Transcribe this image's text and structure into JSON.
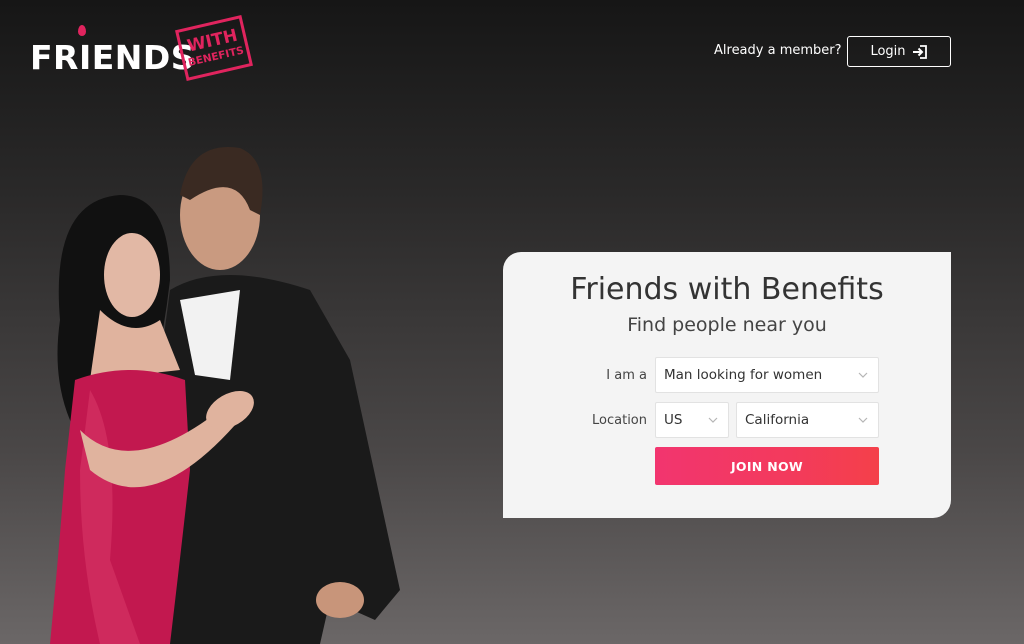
{
  "brand": {
    "name": "FRIENDS",
    "stamp_line1": "WITH",
    "stamp_line2": "BENEFITS",
    "accent_color": "#e0245e"
  },
  "header": {
    "member_prompt": "Already a member?",
    "login_label": "Login",
    "login_icon": "login-icon"
  },
  "hero": {
    "image_subject": "couple-photo"
  },
  "signup": {
    "title": "Friends with Benefits",
    "subtitle": "Find people near you",
    "iam_label": "I am a",
    "iam_value": "Man looking for women",
    "location_label": "Location",
    "country_value": "US",
    "region_value": "California",
    "join_label": "JOIN NOW",
    "join_color": "#f33a5c"
  }
}
